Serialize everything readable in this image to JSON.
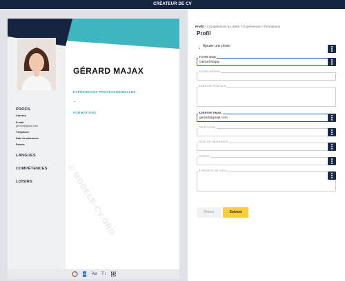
{
  "app": {
    "title": "CRÉATEUR DE CV"
  },
  "breadcrumb": [
    "Profil",
    "Compétences & Loisirs",
    "Expériences",
    "Formations"
  ],
  "form": {
    "title": "Profil",
    "photo_button": "Ajouter une photo",
    "fields": [
      {
        "label": "VOTRE NOM",
        "value": "Gérard Majax",
        "active": true
      },
      {
        "label": "VOTRE MÉTIER",
        "value": ""
      },
      {
        "label": "ADRESSE POSTALE",
        "value": ""
      },
      {
        "label": "ADRESSE EMAIL",
        "value": "gerard@gmail.com",
        "active": true
      },
      {
        "label": "TÉLÉPHONE",
        "value": ""
      },
      {
        "label": "DATE DE NAISSANCE",
        "value": ""
      },
      {
        "label": "PERMIS",
        "value": ""
      },
      {
        "label": "À PROPOS DE VOUS",
        "value": ""
      }
    ],
    "back_button": "Retour",
    "next_button": "Suivant"
  },
  "cv": {
    "name": "GÉRARD MAJAX",
    "sections": {
      "experience": "EXPÉRIENCES PROFESSIONNELLES",
      "education": "FORMATIONS",
      "experience_item": "-"
    },
    "watermark": "© MODELE-CV.ORG",
    "sidebar": {
      "profile_title": "PROFIL",
      "address_label": "Adresse",
      "email_label": "E-mail",
      "email_value": "gerard@gmail.com",
      "phone_label": "Téléphone",
      "birth_label": "Date de naissance",
      "license_label": "Permis",
      "languages_title": "LANGUES",
      "skills_title": "COMPÉTENCES",
      "hobbies_title": "LOISIRS"
    }
  },
  "toolbar": {
    "tools": [
      "palette-icon",
      "document-icon",
      "font-size-icon",
      "text-tool-icon",
      "crop-icon"
    ]
  },
  "colors": {
    "topbar": "#152540",
    "teal": "#3fb5c0",
    "dark_navy": "#1b2b4a",
    "accent_yellow": "#f7cf37"
  }
}
